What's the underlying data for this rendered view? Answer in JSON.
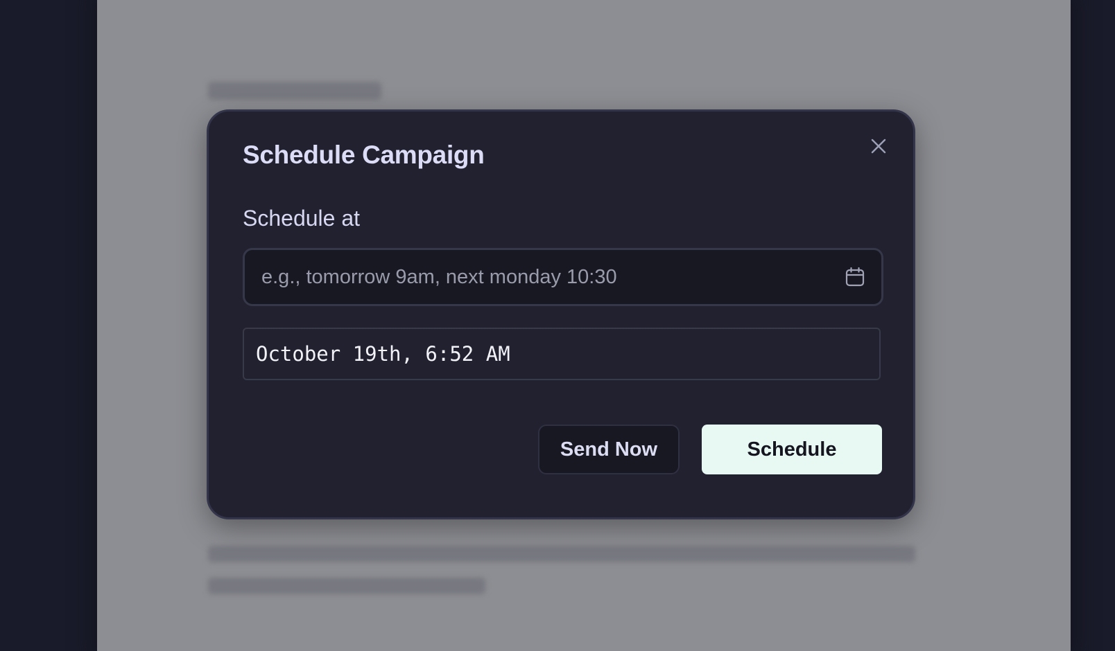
{
  "modal": {
    "title": "Schedule Campaign",
    "close_icon": "close-icon",
    "field_label": "Schedule at",
    "input": {
      "placeholder": "e.g., tomorrow 9am, next monday 10:30",
      "value": "",
      "icon": "calendar-icon"
    },
    "parsed_result": "October 19th, 6:52 AM",
    "buttons": {
      "send_now": "Send Now",
      "schedule": "Schedule"
    }
  },
  "colors": {
    "modal_background": "#21212f",
    "title_text": "#dcdcf7",
    "primary_button_background": "#e8f8f3",
    "secondary_button_background": "#171822",
    "overlay": "#8d8e93"
  }
}
